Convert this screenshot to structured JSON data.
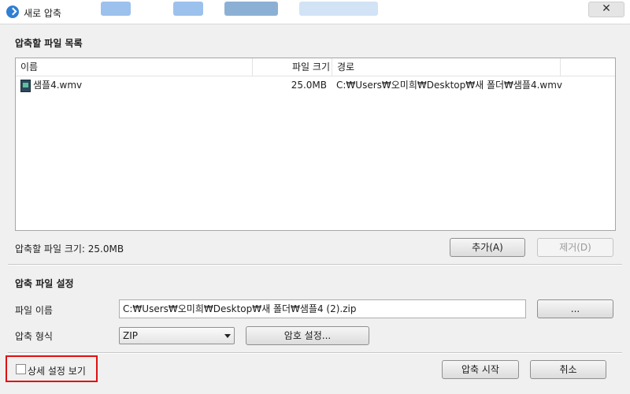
{
  "window": {
    "title": "새로 압축",
    "close_glyph": "✕"
  },
  "file_list": {
    "section_title": "압축할 파일 목록",
    "columns": {
      "name": "이름",
      "size": "파일 크기",
      "path": "경로"
    },
    "rows": [
      {
        "icon": "video-file-icon",
        "name": "샘플4.wmv",
        "size": "25.0MB",
        "path": "C:₩Users₩오미희₩Desktop₩새 폴더₩샘플4.wmv"
      }
    ],
    "total_size_text": "압축할 파일 크기: 25.0MB",
    "add_label": "추가(A)",
    "remove_label": "제거(D)"
  },
  "settings": {
    "section_title": "압축 파일 설정",
    "filename_label": "파일 이름",
    "filename_value": "C:₩Users₩오미희₩Desktop₩새 폴더₩샘플4 (2).zip",
    "browse_label": "...",
    "format_label": "압축 형식",
    "format_value": "ZIP",
    "password_label": "암호 설정..."
  },
  "footer": {
    "advanced_label": "상세 설정 보기",
    "advanced_checked": false,
    "start_label": "압축 시작",
    "cancel_label": "취소"
  },
  "colors": {
    "highlight": "#e01010",
    "accent": "#2f7fd3"
  }
}
